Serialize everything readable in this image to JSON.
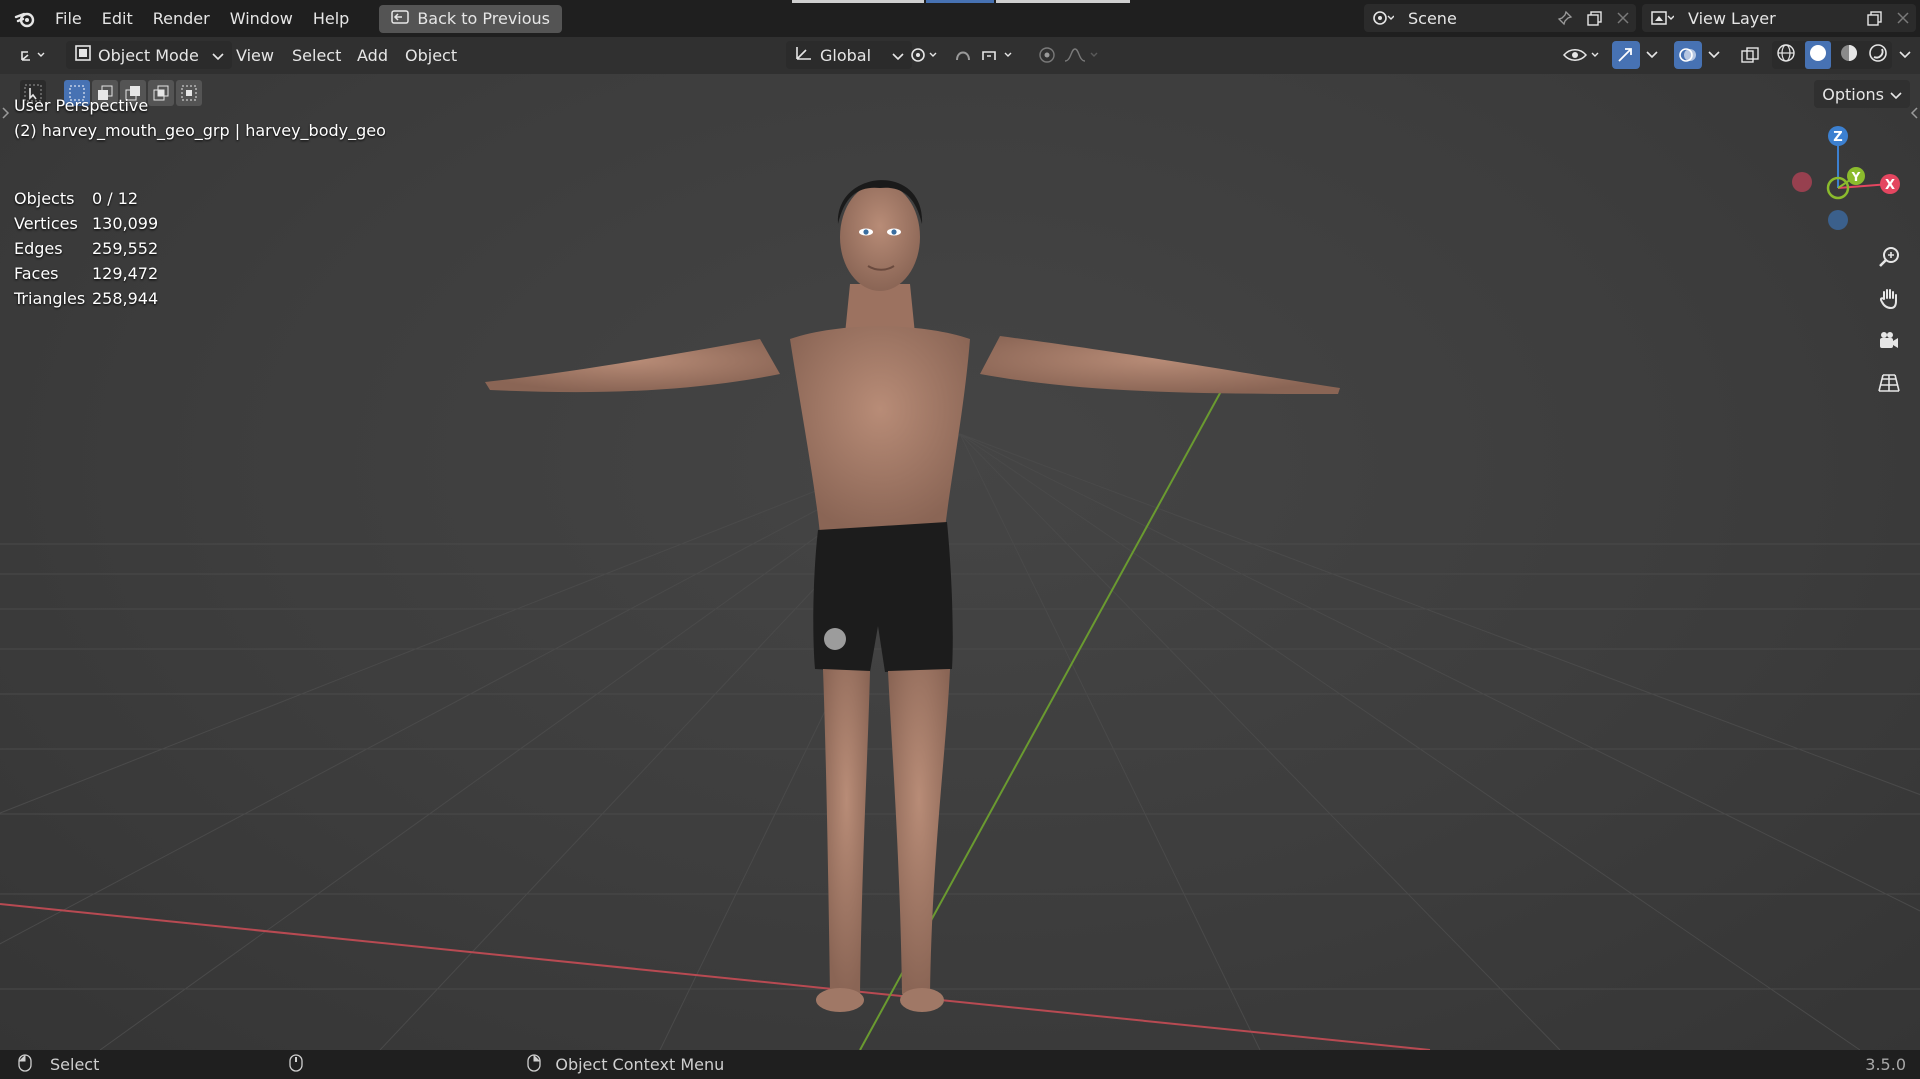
{
  "menubar": {
    "items": [
      "File",
      "Edit",
      "Render",
      "Window",
      "Help"
    ],
    "back_button": "Back to Previous",
    "scene_name": "Scene",
    "view_layer_name": "View Layer"
  },
  "header": {
    "mode": "Object Mode",
    "menus": [
      "View",
      "Select",
      "Add",
      "Object"
    ],
    "transform_orientation": "Global"
  },
  "viewport": {
    "options_label": "Options",
    "perspective_label": "User Perspective",
    "active_object_label": "(2) harvey_mouth_geo_grp | harvey_body_geo",
    "stats": [
      {
        "label": "Objects",
        "value": "0 / 12"
      },
      {
        "label": "Vertices",
        "value": "130,099"
      },
      {
        "label": "Edges",
        "value": "259,552"
      },
      {
        "label": "Faces",
        "value": "129,472"
      },
      {
        "label": "Triangles",
        "value": "258,944"
      }
    ],
    "gizmo": {
      "z": "Z",
      "y": "Y",
      "x": "X"
    }
  },
  "statusbar": {
    "select_label": "Select",
    "context_menu_label": "Object Context Menu",
    "version": "3.5.0"
  },
  "colors": {
    "accent": "#4772b3",
    "x_axis": "#e44660",
    "y_axis": "#8bbb2d",
    "z_axis": "#3c80d0"
  },
  "icons": [
    "blender-logo-icon",
    "back-icon",
    "scene-icon",
    "pin-icon",
    "copy-icon",
    "close-icon",
    "view-layer-icon",
    "editor-type-icon",
    "object-mode-icon",
    "orientation-icon",
    "pivot-icon",
    "snap-icon",
    "proportional-icon",
    "visibility-icon",
    "gizmo-icon",
    "overlay-icon",
    "xray-icon",
    "wireframe-shading-icon",
    "solid-shading-icon",
    "material-shading-icon",
    "rendered-shading-icon",
    "zoom-icon",
    "hand-icon",
    "camera-icon",
    "grid-icon",
    "mouse-left-icon",
    "mouse-middle-icon",
    "mouse-right-icon"
  ]
}
